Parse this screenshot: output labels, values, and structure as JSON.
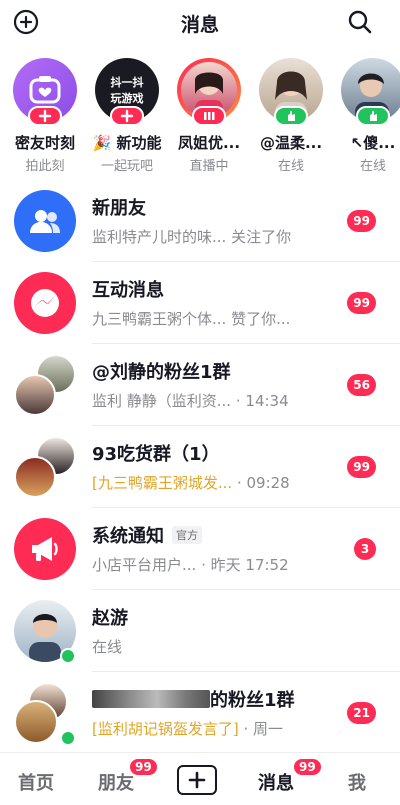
{
  "header": {
    "title": "消息",
    "add_icon": "add-circle-icon",
    "search_icon": "search-icon"
  },
  "stories": [
    {
      "name": "密友时刻",
      "sub": "拍此刻",
      "badge_icon": "heart-plus-icon"
    },
    {
      "name": "🎉 新功能",
      "sub": "一起玩吧",
      "avatar_text_1": "抖一抖",
      "avatar_text_2": "玩游戏",
      "badge_icon": "plus-icon"
    },
    {
      "name": "凤姐优...",
      "sub": "直播中",
      "badge_icon": "live-icon"
    },
    {
      "name": "@温柔...",
      "sub": "在线",
      "badge_icon": "wave-hand-icon"
    },
    {
      "name": "↖傻...",
      "sub": "在线",
      "badge_icon": "wave-hand-icon"
    }
  ],
  "messages": [
    {
      "title": "新朋友",
      "sub": "监利特产儿时的味... 关注了你",
      "time": "",
      "unread": "99",
      "icon": "people-icon",
      "color": "#2f6ef7"
    },
    {
      "title": "互动消息",
      "sub": "九三鸭霸王粥个体... 赞了你...",
      "time": "",
      "unread": "99",
      "icon": "chat-bolt-icon",
      "color": "#fe2c55"
    },
    {
      "title": "@刘静的粉丝1群",
      "sub": "监利 静静（监利资...",
      "time": "· 14:34",
      "unread": "56"
    },
    {
      "title": "93吃货群（1）",
      "sub": "[九三鸭霸王粥城发...",
      "time": "· 09:28",
      "unread": "99",
      "highlight": true
    },
    {
      "title": "系统通知",
      "tag": "官方",
      "sub": "小店平台用户...",
      "time": "· 昨天 17:52",
      "unread": "3",
      "icon": "megaphone-icon",
      "color": "#fe2c55"
    },
    {
      "title": "赵游",
      "sub": "在线",
      "time": "",
      "unread": "",
      "online": true
    },
    {
      "title": "的粉丝1群",
      "sub": "[监利胡记锅盔发言了]",
      "time": "· 周一",
      "unread": "21",
      "highlight": true,
      "online": true
    }
  ],
  "nav": {
    "home": "首页",
    "friends": "朋友",
    "friends_badge": "99",
    "messages": "消息",
    "messages_badge": "99",
    "me": "我",
    "plus_icon": "plus-icon"
  }
}
